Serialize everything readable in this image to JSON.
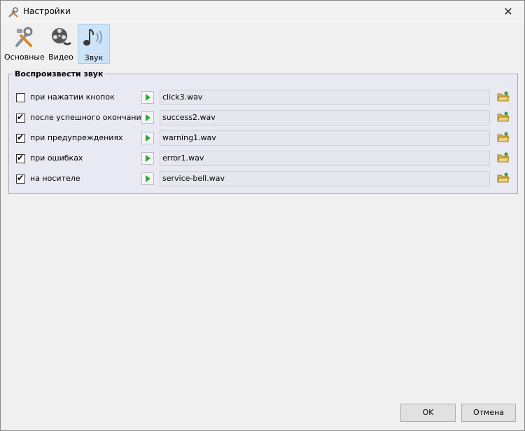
{
  "window": {
    "title": "Настройки",
    "close_glyph": "✕"
  },
  "toolbar": {
    "items": [
      {
        "label": "Основные",
        "icon": "tools-icon",
        "active": false
      },
      {
        "label": "Видео",
        "icon": "film-reel-icon",
        "active": false
      },
      {
        "label": "Звук",
        "icon": "music-note-icon",
        "active": true
      }
    ]
  },
  "sound_group": {
    "title": "Воспроизвести звук",
    "rows": [
      {
        "label": "при нажатии кнопок",
        "checked": false,
        "file": "click3.wav"
      },
      {
        "label": "после успешного окончания",
        "checked": true,
        "file": "success2.wav"
      },
      {
        "label": "при предупреждениях",
        "checked": true,
        "file": "warning1.wav"
      },
      {
        "label": "при ошибках",
        "checked": true,
        "file": "error1.wav"
      },
      {
        "label": "на носителе",
        "checked": true,
        "file": "service-bell.wav"
      }
    ]
  },
  "buttons": {
    "ok": "OK",
    "cancel": "Отмена"
  }
}
